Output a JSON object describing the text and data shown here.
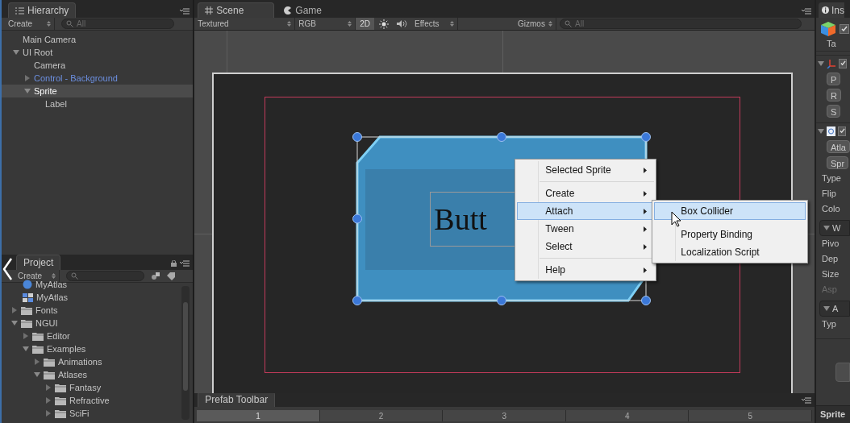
{
  "hierarchy": {
    "tab": "Hierarchy",
    "create": "Create",
    "search_placeholder": "All",
    "items": [
      {
        "label": "Main Camera",
        "prefab": false,
        "selected": false
      },
      {
        "label": "UI Root",
        "prefab": false,
        "selected": false,
        "expanded": true,
        "children": [
          {
            "label": "Camera",
            "prefab": false,
            "selected": false
          },
          {
            "label": "Control - Background",
            "prefab": true,
            "selected": false,
            "expanded": false
          },
          {
            "label": "Sprite",
            "prefab": false,
            "selected": true,
            "expanded": true,
            "children": [
              {
                "label": "Label",
                "prefab": false,
                "selected": false
              }
            ]
          }
        ]
      }
    ]
  },
  "project": {
    "tab": "Project",
    "create": "Create",
    "items": [
      {
        "label": "MyAtlas",
        "kind": "prefab"
      },
      {
        "label": "MyAtlas",
        "kind": "atlas"
      },
      {
        "label": "Fonts",
        "kind": "folder",
        "expanded": false
      },
      {
        "label": "NGUI",
        "kind": "folder",
        "expanded": true,
        "children": [
          {
            "label": "Editor",
            "kind": "folder",
            "expanded": false
          },
          {
            "label": "Examples",
            "kind": "folder",
            "expanded": true,
            "children": [
              {
                "label": "Animations",
                "kind": "folder",
                "expanded": false
              },
              {
                "label": "Atlases",
                "kind": "folder",
                "expanded": true,
                "children": [
                  {
                    "label": "Fantasy",
                    "kind": "folder",
                    "expanded": false
                  },
                  {
                    "label": "Refractive",
                    "kind": "folder",
                    "expanded": false
                  },
                  {
                    "label": "SciFi",
                    "kind": "folder",
                    "expanded": false
                  }
                ]
              }
            ]
          }
        ]
      }
    ]
  },
  "scene": {
    "tabs": [
      {
        "label": "Scene",
        "kind": "scene",
        "selected": true
      },
      {
        "label": "Game",
        "kind": "game",
        "selected": false
      }
    ],
    "toolbar": {
      "shading": "Textured",
      "channel": "RGB",
      "mode_2d": {
        "label": "2D",
        "on": true
      },
      "effects": "Effects",
      "gizmos": "Gizmos",
      "search_placeholder": "All"
    },
    "label_text": "Butt",
    "menu": [
      {
        "kind": "item",
        "label": "Selected Sprite",
        "highlighted": false
      },
      {
        "kind": "separator"
      },
      {
        "kind": "item",
        "label": "Create",
        "highlighted": false
      },
      {
        "kind": "item",
        "label": "Attach",
        "highlighted": true
      },
      {
        "kind": "item",
        "label": "Tween",
        "highlighted": false
      },
      {
        "kind": "item",
        "label": "Select",
        "highlighted": false
      },
      {
        "kind": "separator"
      },
      {
        "kind": "item",
        "label": "Help",
        "highlighted": false
      }
    ],
    "submenu": [
      {
        "label": "Box Collider",
        "highlighted": true
      },
      {
        "label": "Property Binding",
        "highlighted": false
      },
      {
        "label": "Localization Script",
        "highlighted": false
      }
    ]
  },
  "prefab_toolbar": {
    "tab": "Prefab Toolbar",
    "pages": [
      {
        "label": "1",
        "selected": true
      },
      {
        "label": "2",
        "selected": false
      },
      {
        "label": "3",
        "selected": false
      },
      {
        "label": "4",
        "selected": false
      },
      {
        "label": "5",
        "selected": false
      }
    ]
  },
  "inspector": {
    "tab": "Ins",
    "rows": [
      {
        "kind": "object",
        "label": "Ta",
        "checked": true
      },
      {
        "kind": "transform",
        "checked": true
      },
      {
        "kind": "button",
        "label": "P"
      },
      {
        "kind": "button",
        "label": "R"
      },
      {
        "kind": "button",
        "label": "S"
      },
      {
        "kind": "widget",
        "checked": true
      },
      {
        "kind": "button",
        "label": "Atla"
      },
      {
        "kind": "button",
        "label": "Spr"
      },
      {
        "kind": "field",
        "label": "Type"
      },
      {
        "kind": "field",
        "label": "Flip"
      },
      {
        "kind": "field",
        "label": "Colo"
      },
      {
        "kind": "section",
        "label": "W"
      },
      {
        "kind": "field",
        "label": "Pivo"
      },
      {
        "kind": "field",
        "label": "Dep"
      },
      {
        "kind": "field",
        "label": "Size"
      },
      {
        "kind": "dimmed",
        "label": "Asp"
      },
      {
        "kind": "section",
        "label": "A"
      },
      {
        "kind": "field",
        "label": "Typ"
      },
      {
        "kind": "blank_button"
      },
      {
        "kind": "footer",
        "label": "Sprite"
      }
    ]
  }
}
